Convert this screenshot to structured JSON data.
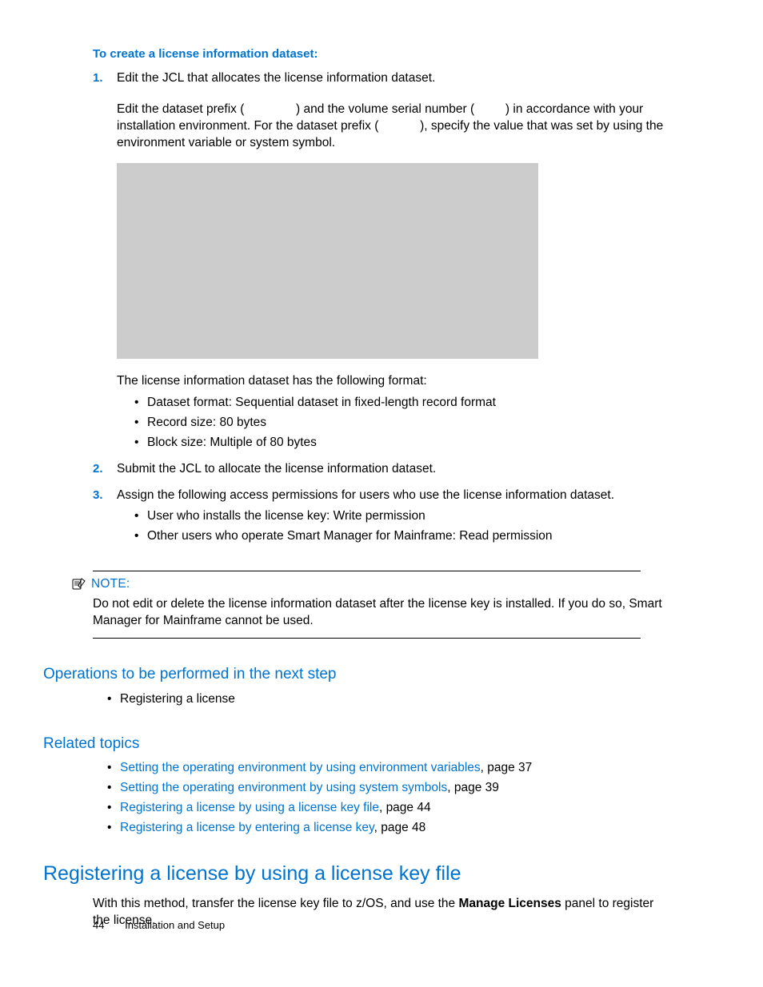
{
  "intro_heading": "To create a license information dataset:",
  "steps": {
    "s1": {
      "num": "1.",
      "p1": "Edit the JCL that allocates the license information dataset.",
      "p2a": "Edit the dataset prefix (",
      "p2b": ") and the volume serial number (",
      "p2c": ") in accordance with your installation environment. For the dataset prefix (",
      "p2d": "), specify the value that was set by using the environment variable or system symbol.",
      "p3": "The license information dataset has the following format:",
      "bul": [
        "Dataset format: Sequential dataset in fixed-length record format",
        "Record size: 80 bytes",
        "Block size: Multiple of 80 bytes"
      ]
    },
    "s2": {
      "num": "2.",
      "p1": "Submit the JCL to allocate the license information dataset."
    },
    "s3": {
      "num": "3.",
      "p1": "Assign the following access permissions for users who use the license information dataset.",
      "bul": [
        "User who installs the license key: Write permission",
        "Other users who operate Smart Manager for Mainframe: Read permission"
      ]
    }
  },
  "note": {
    "label": "NOTE:",
    "body": "Do not edit or delete the license information dataset after the license key is installed. If you do so, Smart Manager for Mainframe cannot be used."
  },
  "next_step": {
    "heading": "Operations to be performed in the next step",
    "items": [
      "Registering a license"
    ]
  },
  "related": {
    "heading": "Related topics",
    "items": [
      {
        "link": "Setting the operating environment by using environment variables",
        "suffix": ", page 37"
      },
      {
        "link": "Setting the operating environment by using system symbols",
        "suffix": ", page 39"
      },
      {
        "link": "Registering a license by using a license key file",
        "suffix": ", page 44"
      },
      {
        "link": "Registering a license by entering a license key",
        "suffix": ", page 48"
      }
    ]
  },
  "section": {
    "heading": "Registering a license by using a license key file",
    "p_a": "With this method, transfer the license key file to z/OS, and use the ",
    "p_bold": "Manage Licenses",
    "p_b": " panel to register the license."
  },
  "footer": {
    "page": "44",
    "title": "Installation and Setup"
  }
}
